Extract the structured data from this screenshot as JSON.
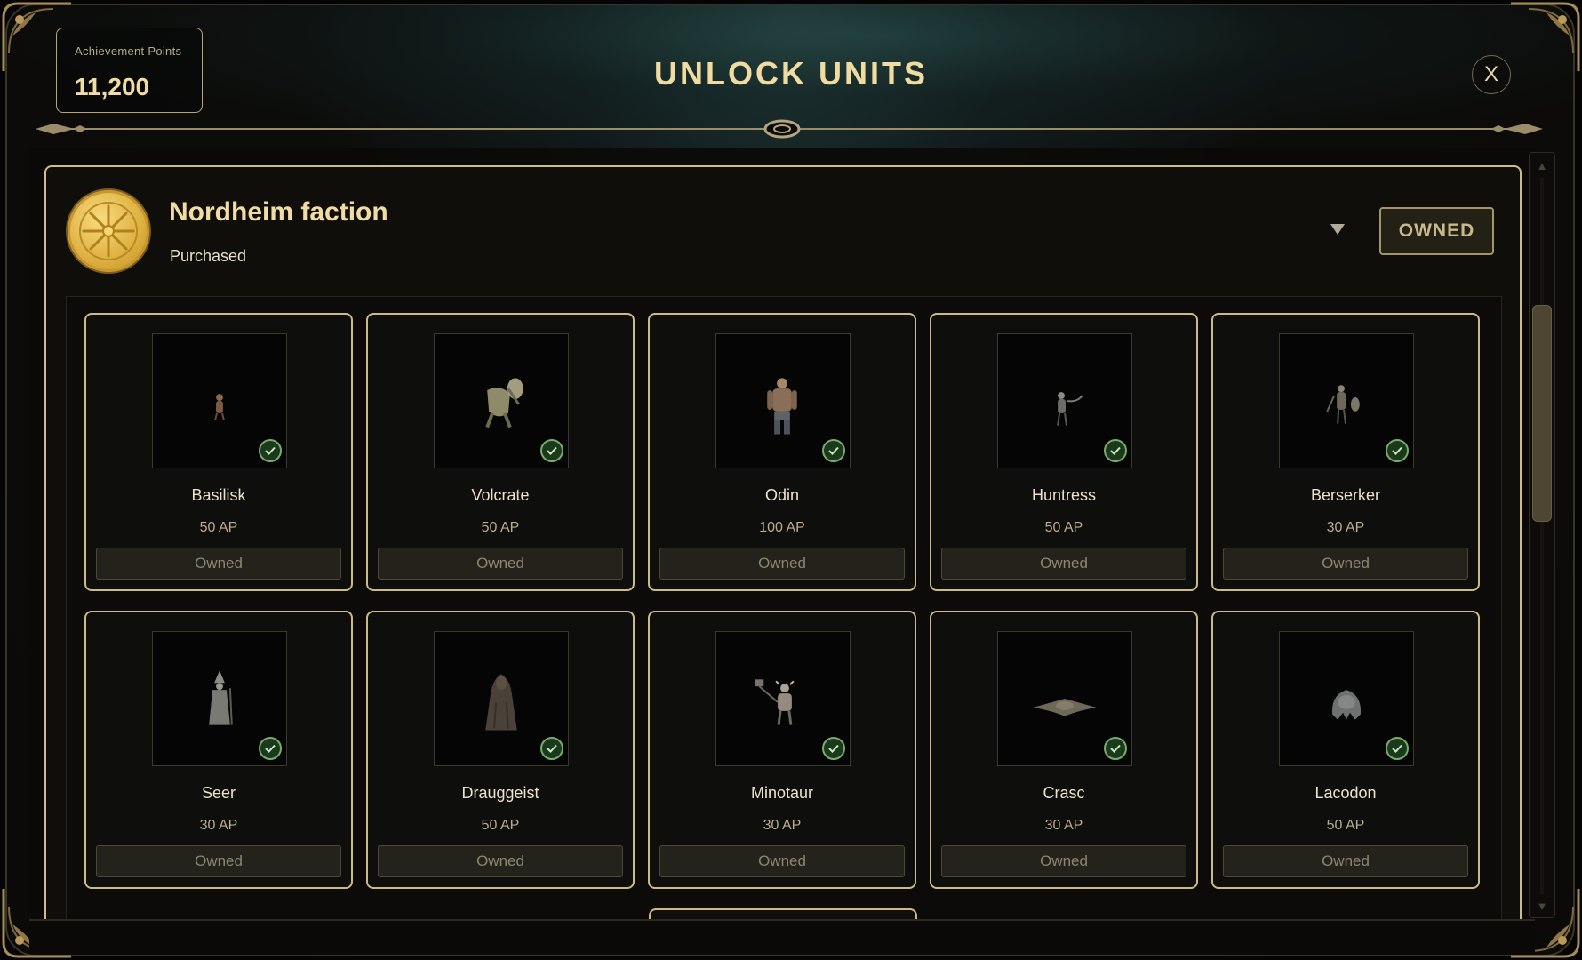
{
  "header": {
    "title": "UNLOCK UNITS",
    "achievement_label": "Achievement Points",
    "achievement_value": "11,200",
    "close_label": "X"
  },
  "faction": {
    "name": "Nordheim faction",
    "status": "Purchased",
    "badge": "OWNED",
    "emblem_icon": "sun-wheel-icon",
    "expand_icon": "triangle-down-icon"
  },
  "units": [
    {
      "name": "Basilisk",
      "cost": "50 AP",
      "button": "Owned",
      "icon": "basilisk-figure"
    },
    {
      "name": "Volcrate",
      "cost": "50 AP",
      "button": "Owned",
      "icon": "volcrate-figure"
    },
    {
      "name": "Odin",
      "cost": "100 AP",
      "button": "Owned",
      "icon": "odin-figure"
    },
    {
      "name": "Huntress",
      "cost": "50 AP",
      "button": "Owned",
      "icon": "huntress-figure"
    },
    {
      "name": "Berserker",
      "cost": "30 AP",
      "button": "Owned",
      "icon": "berserker-figure"
    },
    {
      "name": "Seer",
      "cost": "30 AP",
      "button": "Owned",
      "icon": "seer-figure"
    },
    {
      "name": "Drauggeist",
      "cost": "50 AP",
      "button": "Owned",
      "icon": "drauggeist-figure"
    },
    {
      "name": "Minotaur",
      "cost": "30 AP",
      "button": "Owned",
      "icon": "minotaur-figure"
    },
    {
      "name": "Crasc",
      "cost": "30 AP",
      "button": "Owned",
      "icon": "crasc-figure"
    },
    {
      "name": "Lacodon",
      "cost": "50 AP",
      "button": "Owned",
      "icon": "lacodon-figure"
    }
  ],
  "colors": {
    "gold": "#cfbd88",
    "title": "#f0dba0",
    "check": "#7caa6d",
    "background": "#0e0f0c"
  }
}
